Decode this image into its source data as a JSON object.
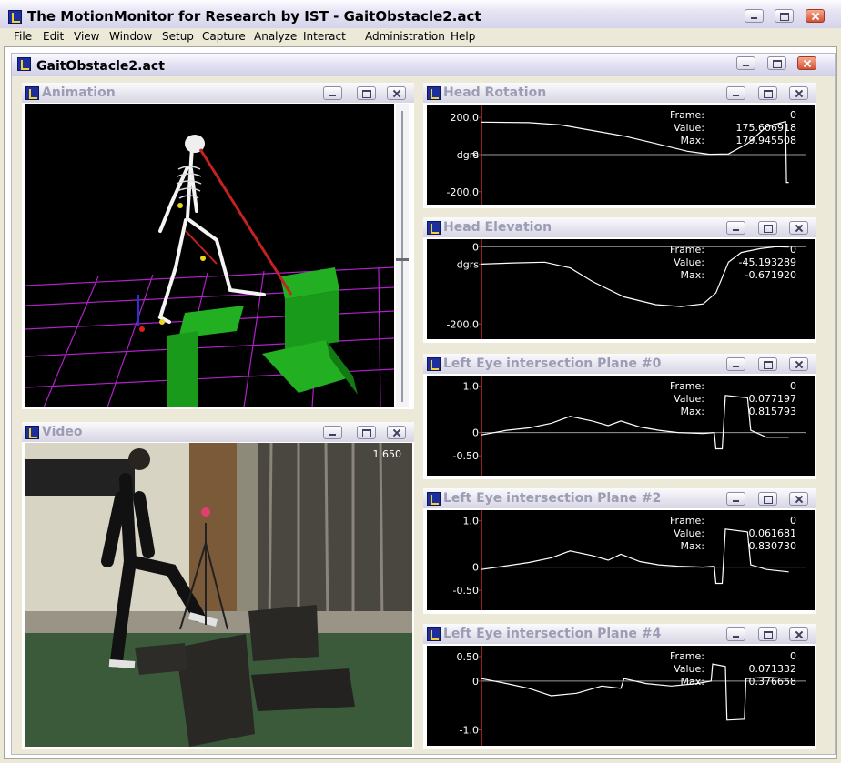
{
  "app": {
    "title": "The MotionMonitor for Research by IST - GaitObstacle2.act",
    "menu": [
      "File",
      "Edit",
      "View",
      "Window",
      "Setup",
      "Capture",
      "Analyze",
      "Interact",
      "Administration",
      "Help"
    ]
  },
  "document": {
    "title": "GaitObstacle2.act"
  },
  "panels": {
    "animation": {
      "title": "Animation"
    },
    "video": {
      "title": "Video",
      "frame_label": "1 650"
    }
  },
  "graphs": [
    {
      "title": "Head Rotation",
      "ticks": [
        "200.0",
        "dgrs",
        "-200.0"
      ],
      "tick_zero_label": "0",
      "frame_label": "Frame:",
      "frame_value": "0",
      "value_label": "Value:",
      "value_value": "175.606918",
      "max_label": "Max:",
      "max_value": "179.945508",
      "ylim": [
        -250,
        250
      ],
      "tick_values": [
        200,
        0,
        -200
      ],
      "points": [
        [
          0,
          175
        ],
        [
          0.15,
          172
        ],
        [
          0.25,
          160
        ],
        [
          0.35,
          130
        ],
        [
          0.45,
          100
        ],
        [
          0.55,
          60
        ],
        [
          0.65,
          18
        ],
        [
          0.72,
          2
        ],
        [
          0.78,
          4
        ],
        [
          0.84,
          60
        ],
        [
          0.9,
          150
        ],
        [
          0.96,
          178
        ],
        [
          0.963,
          -150
        ],
        [
          0.97,
          -150
        ]
      ]
    },
    {
      "title": "Head Elevation",
      "ticks": [
        "0",
        "dgrs",
        "-200.0"
      ],
      "frame_label": "Frame:",
      "frame_value": "0",
      "value_label": "Value:",
      "value_value": "-45.193289",
      "max_label": "Max:",
      "max_value": "-0.671920",
      "ylim": [
        -230,
        10
      ],
      "tick_values": [
        0,
        -100,
        -200
      ],
      "points": [
        [
          0,
          -45
        ],
        [
          0.1,
          -42
        ],
        [
          0.2,
          -40
        ],
        [
          0.28,
          -55
        ],
        [
          0.35,
          -90
        ],
        [
          0.45,
          -130
        ],
        [
          0.55,
          -150
        ],
        [
          0.63,
          -155
        ],
        [
          0.7,
          -148
        ],
        [
          0.74,
          -120
        ],
        [
          0.78,
          -40
        ],
        [
          0.82,
          -15
        ],
        [
          0.88,
          -5
        ],
        [
          0.93,
          0
        ],
        [
          0.97,
          -1
        ]
      ]
    },
    {
      "title": "Left Eye intersection Plane #0",
      "ticks": [
        "1.0",
        "0",
        "-0.50"
      ],
      "frame_label": "Frame:",
      "frame_value": "0",
      "value_label": "Value:",
      "value_value": "0.077197",
      "max_label": "Max:",
      "max_value": "0.815793",
      "ylim": [
        -0.85,
        1.15
      ],
      "tick_values": [
        1.0,
        0,
        -0.5
      ],
      "points": [
        [
          0,
          -0.05
        ],
        [
          0.08,
          0.05
        ],
        [
          0.15,
          0.1
        ],
        [
          0.22,
          0.2
        ],
        [
          0.28,
          0.35
        ],
        [
          0.35,
          0.25
        ],
        [
          0.4,
          0.15
        ],
        [
          0.44,
          0.25
        ],
        [
          0.5,
          0.12
        ],
        [
          0.56,
          0.05
        ],
        [
          0.62,
          0.0
        ],
        [
          0.7,
          -0.02
        ],
        [
          0.735,
          0.0
        ],
        [
          0.74,
          -0.35
        ],
        [
          0.76,
          -0.35
        ],
        [
          0.77,
          0.8
        ],
        [
          0.84,
          0.75
        ],
        [
          0.85,
          0.05
        ],
        [
          0.9,
          -0.1
        ],
        [
          0.97,
          -0.1
        ]
      ]
    },
    {
      "title": "Left Eye intersection Plane #2",
      "ticks": [
        "1.0",
        "0",
        "-0.50"
      ],
      "frame_label": "Frame:",
      "frame_value": "0",
      "value_label": "Value:",
      "value_value": "0.061681",
      "max_label": "Max:",
      "max_value": "0.830730",
      "ylim": [
        -0.85,
        1.15
      ],
      "tick_values": [
        1.0,
        0,
        -0.5
      ],
      "points": [
        [
          0,
          -0.05
        ],
        [
          0.08,
          0.03
        ],
        [
          0.15,
          0.1
        ],
        [
          0.22,
          0.2
        ],
        [
          0.28,
          0.35
        ],
        [
          0.35,
          0.25
        ],
        [
          0.4,
          0.15
        ],
        [
          0.44,
          0.28
        ],
        [
          0.5,
          0.12
        ],
        [
          0.56,
          0.05
        ],
        [
          0.62,
          0.02
        ],
        [
          0.7,
          0.0
        ],
        [
          0.735,
          0.02
        ],
        [
          0.74,
          -0.35
        ],
        [
          0.76,
          -0.35
        ],
        [
          0.77,
          0.82
        ],
        [
          0.84,
          0.76
        ],
        [
          0.85,
          0.05
        ],
        [
          0.9,
          -0.05
        ],
        [
          0.97,
          -0.1
        ]
      ]
    },
    {
      "title": "Left Eye intersection Plane #4",
      "ticks": [
        "0.50",
        "0",
        "-1.0"
      ],
      "frame_label": "Frame:",
      "frame_value": "0",
      "value_label": "Value:",
      "value_value": "0.071332",
      "max_label": "Max:",
      "max_value": "0.376658",
      "ylim": [
        -1.25,
        0.65
      ],
      "tick_values": [
        0.5,
        0,
        -1.0
      ],
      "points": [
        [
          0,
          0.05
        ],
        [
          0.08,
          -0.05
        ],
        [
          0.15,
          -0.15
        ],
        [
          0.22,
          -0.3
        ],
        [
          0.3,
          -0.25
        ],
        [
          0.38,
          -0.1
        ],
        [
          0.44,
          -0.15
        ],
        [
          0.45,
          0.05
        ],
        [
          0.52,
          -0.05
        ],
        [
          0.6,
          -0.1
        ],
        [
          0.68,
          -0.05
        ],
        [
          0.725,
          0.0
        ],
        [
          0.73,
          0.35
        ],
        [
          0.77,
          0.3
        ],
        [
          0.775,
          -0.8
        ],
        [
          0.83,
          -0.78
        ],
        [
          0.835,
          0.05
        ],
        [
          0.9,
          0.08
        ],
        [
          0.97,
          0.05
        ]
      ]
    }
  ],
  "colors": {
    "accent": "#1d2f9a",
    "close": "#d45234",
    "graph_line": "#ffffff",
    "axis_red": "#c42a2a"
  }
}
